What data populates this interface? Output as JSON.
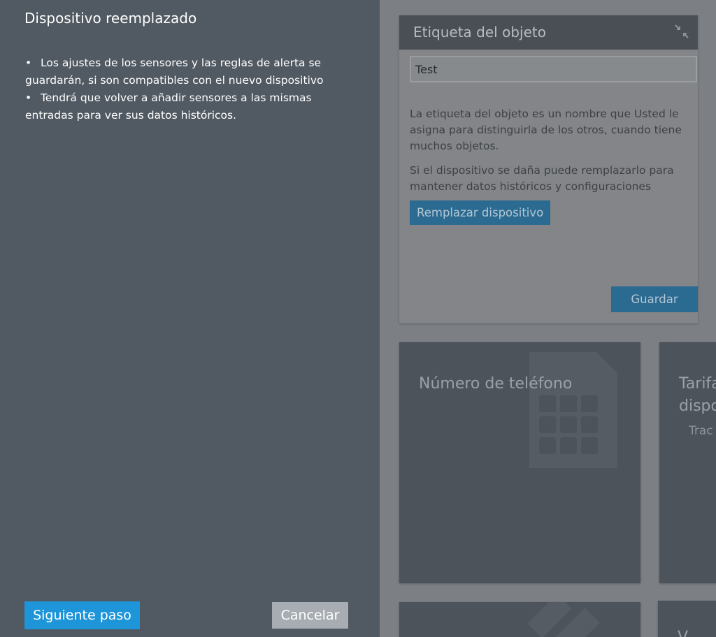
{
  "panel": {
    "title": "Dispositivo reemplazado",
    "notes": [
      "Los ajustes de los sensores y las reglas de alerta se guardarán, si son compatibles con el nuevo dispositivo",
      "Tendrá que volver a añadir sensores a las mismas entradas para ver sus datos históricos."
    ],
    "bullet": "•",
    "next_label": "Siguiente paso",
    "cancel_label": "Cancelar"
  },
  "label_card": {
    "title": "Etiqueta del objeto",
    "collapse_icon": "collapse-arrows-icon",
    "field_value": "Test",
    "description": "La etiqueta del objeto es un nombre que Usted le asigna para distinguirla de los otros, cuando tiene muchos objetos.",
    "replace_hint": "Si el dispositivo se daña puede remplazarlo para mantener datos históricos y configuraciones",
    "replace_label": "Remplazar dispositivo",
    "save_label": "Guardar"
  },
  "tiles": {
    "phone_title": "Número de teléfono",
    "phone_icon": "sim-card-icon",
    "tariff_title_line1": "Tarifa",
    "tariff_title_line2": "dispo",
    "tariff_sub": "Trac",
    "bottom_left_icon": "tools-icon",
    "bottom_right_partial": "V"
  },
  "colors": {
    "panel_bg": "#515962",
    "primary_button": "#1d95d8",
    "secondary_button": "#a8adb3",
    "overlay_bg": "#7c8085"
  }
}
